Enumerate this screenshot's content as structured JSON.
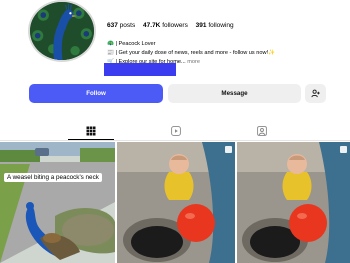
{
  "profile": {
    "posts_count": "637",
    "posts_label": "posts",
    "followers_count": "47.7K",
    "followers_label": "followers",
    "following_count": "391",
    "following_label": "following"
  },
  "bio": {
    "line1": "🦚 | Peacock Lover",
    "line2": "📰 | Get your daily dose of news, reels and more - follow us now!✨",
    "line3": "🛒 | Explore our site for home...",
    "more": "more"
  },
  "actions": {
    "follow_label": "Follow",
    "message_label": "Message"
  },
  "posts": {
    "caption1": "A weasel biting a peacock's neck"
  },
  "colors": {
    "follow_button": "#4c5bf5",
    "link_bar": "#3b3bf0"
  }
}
